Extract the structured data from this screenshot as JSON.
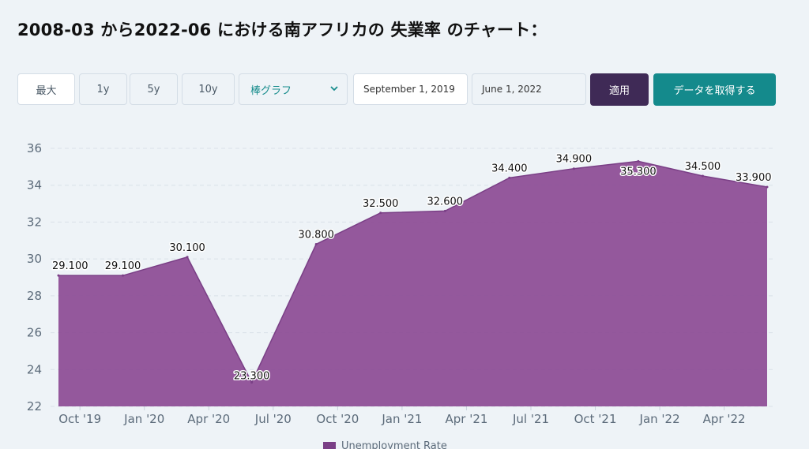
{
  "page": {
    "title": "2008-03 から2022-06 における南アフリカの 失業率 のチャート："
  },
  "toolbar": {
    "range_buttons": [
      "最大",
      "1y",
      "5y",
      "10y"
    ],
    "chart_type_selected": "棒グラフ",
    "start_date": "September 1, 2019",
    "end_date": "June 1, 2022",
    "apply_label": "適用",
    "fetch_label": "データを取得する"
  },
  "colors": {
    "area_fill": "#8e4f97",
    "area_line": "#7a3f86",
    "apply_bg": "#3f2a56",
    "fetch_bg": "#148a8c"
  },
  "chart_data": {
    "type": "area",
    "x": [
      "2019-09",
      "2019-12",
      "2020-03",
      "2020-06",
      "2020-09",
      "2020-12",
      "2021-03",
      "2021-06",
      "2021-09",
      "2021-12",
      "2022-03",
      "2022-06"
    ],
    "series": [
      {
        "name": "Unemployment Rate",
        "values": [
          29.1,
          29.1,
          30.1,
          23.3,
          30.8,
          32.5,
          32.6,
          34.4,
          34.9,
          35.3,
          34.5,
          33.9
        ]
      }
    ],
    "data_labels": [
      "29.100",
      "29.100",
      "30.100",
      "23.300",
      "30.800",
      "32.500",
      "32.600",
      "34.400",
      "34.900",
      "35.300",
      "34.500",
      "33.900"
    ],
    "x_tick_labels": [
      "Oct '19",
      "Jan '20",
      "Apr '20",
      "Jul '20",
      "Oct '20",
      "Jan '21",
      "Apr '21",
      "Jul '21",
      "Oct '21",
      "Jan '22",
      "Apr '22"
    ],
    "y_ticks": [
      22,
      24,
      26,
      28,
      30,
      32,
      34,
      36
    ],
    "ylim": [
      22,
      36
    ],
    "grid": true,
    "legend_position": "bottom"
  }
}
